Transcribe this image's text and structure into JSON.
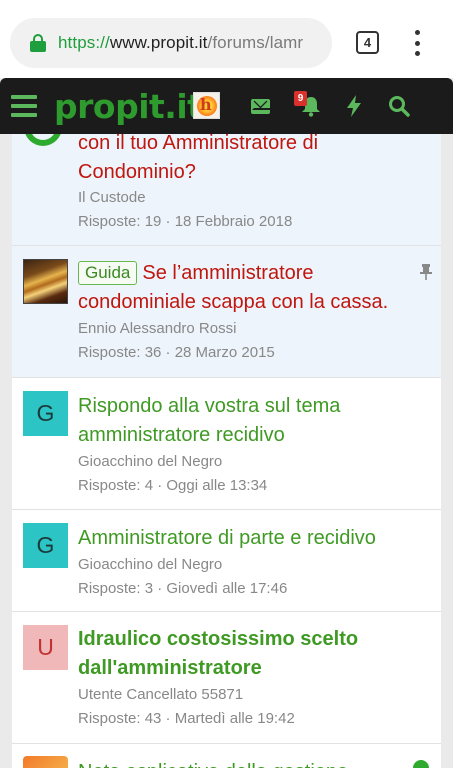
{
  "browser": {
    "url_scheme": "https://",
    "url_host": "www.propit.it",
    "url_path": "/forums/lamr",
    "tab_count": "4"
  },
  "navbar": {
    "logo": "propit.it",
    "notification_count": "9"
  },
  "threads": [
    {
      "title": "con il tuo Amministratore di Condominio?",
      "author": "Il Custode",
      "meta": "Risposte: 19 · 18 Febbraio 2018"
    },
    {
      "prefix": "Guida",
      "title": "Se l’amministratore condominiale scappa con la cassa.",
      "author": "Ennio Alessandro Rossi",
      "meta": "Risposte: 36 · 28 Marzo 2015"
    },
    {
      "avatar_letter": "G",
      "title": "Rispondo alla vostra sul tema amministratore recidivo",
      "author": "Gioacchino del Negro",
      "meta": "Risposte: 4 · Oggi alle 13:34"
    },
    {
      "avatar_letter": "G",
      "title": "Amministratore di parte e recidivo",
      "author": "Gioacchino del Negro",
      "meta": "Risposte: 3 · Giovedì alle 17:46"
    },
    {
      "avatar_letter": "U",
      "title": "Idraulico costosissimo scelto dall'amministratore",
      "author": "Utente Cancellato 55871",
      "meta": "Risposte: 43 · Martedì alle 19:42"
    },
    {
      "title": "Nota esplicativa della gestione"
    }
  ]
}
